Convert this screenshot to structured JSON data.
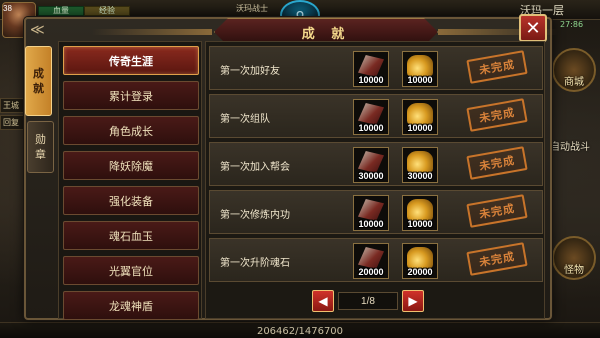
{
  "hud": {
    "level": "38",
    "hp_label": "血量",
    "mp_label": "经验",
    "player_name": "沃玛战士",
    "logo_text": "Q",
    "location": "沃玛一层",
    "coords": "27:86",
    "left_tags": [
      "王城",
      "回复"
    ],
    "shop_label": "商城",
    "auto_battle_label": "自动战斗",
    "boss_label": "怪物",
    "exp_text": "206462/1476700"
  },
  "dialog": {
    "title": "成 就",
    "tabs": [
      {
        "line1": "成",
        "line2": "就"
      },
      {
        "line1": "勋",
        "line2": "章"
      }
    ],
    "categories": [
      {
        "label": "传奇生涯",
        "selected": true
      },
      {
        "label": "累计登录",
        "selected": false
      },
      {
        "label": "角色成长",
        "selected": false
      },
      {
        "label": "降妖除魔",
        "selected": false
      },
      {
        "label": "强化装备",
        "selected": false
      },
      {
        "label": "魂石血玉",
        "selected": false
      },
      {
        "label": "光翼官位",
        "selected": false
      },
      {
        "label": "龙魂神盾",
        "selected": false
      }
    ],
    "achievements": [
      {
        "label": "第一次加好友",
        "reward1": {
          "icon": "red-crystal-icon",
          "amount": "10000"
        },
        "reward2": {
          "icon": "gold-pile-icon",
          "amount": "10000"
        },
        "status": "未完成"
      },
      {
        "label": "第一次组队",
        "reward1": {
          "icon": "red-crystal-icon",
          "amount": "10000"
        },
        "reward2": {
          "icon": "gold-pile-icon",
          "amount": "10000"
        },
        "status": "未完成"
      },
      {
        "label": "第一次加入帮会",
        "reward1": {
          "icon": "red-crystal-icon",
          "amount": "30000"
        },
        "reward2": {
          "icon": "gold-pile-icon",
          "amount": "30000"
        },
        "status": "未完成"
      },
      {
        "label": "第一次修炼内功",
        "reward1": {
          "icon": "red-crystal-icon",
          "amount": "10000"
        },
        "reward2": {
          "icon": "gold-pile-icon",
          "amount": "10000"
        },
        "status": "未完成"
      },
      {
        "label": "第一次升阶魂石",
        "reward1": {
          "icon": "red-crystal-icon",
          "amount": "20000"
        },
        "reward2": {
          "icon": "gold-pile-icon",
          "amount": "20000"
        },
        "status": "未完成"
      }
    ],
    "pagination": {
      "current": "1",
      "total": "8",
      "display": "1/8",
      "prev_icon": "triangle-left-icon",
      "next_icon": "triangle-right-icon"
    },
    "close_icon": "close-icon"
  },
  "colors": {
    "accent_gold": "#e0a84a",
    "stamp_orange": "#d8823a",
    "selected_red": "#8a2a1e"
  }
}
